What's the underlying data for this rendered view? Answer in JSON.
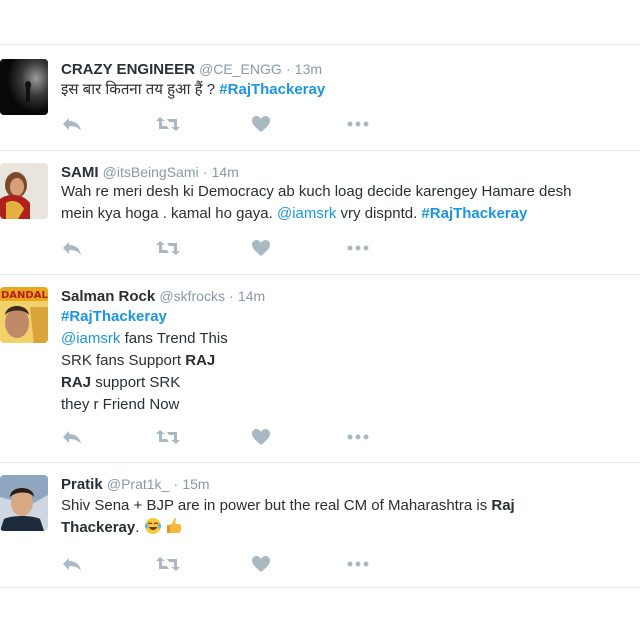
{
  "tweets": [
    {
      "name": "CRAZY ENGINEER",
      "handle": "@CE_ENGG",
      "sep": "·",
      "time": "13m",
      "text": "इस बार कितना तय हुआ हैं ?",
      "hashtag": "#RajThackeray"
    },
    {
      "name": "SAMI",
      "handle": "@itsBeingSami",
      "sep": "·",
      "time": "14m",
      "line1": "Wah re meri desh ki Democracy ab kuch loag decide karengey Hamare desh",
      "line2_text": "mein kya hoga . kamal ho gaya.",
      "mention": "@iamsrk",
      "line2_after": "vry dispntd.",
      "hashtag": "#RajThackeray"
    },
    {
      "name": "Salman Rock",
      "handle": "@skfrocks",
      "sep": "·",
      "time": "14m",
      "hashtag": "#RajThackeray",
      "mention": "@iamsrk",
      "line2_after": "fans Trend This",
      "line3_text": "SRK fans Support",
      "line3_bold": "RAJ",
      "line4_bold": "RAJ",
      "line4_text": "support SRK",
      "line5": "they r Friend Now",
      "avatar_text": "DANDAL"
    },
    {
      "name": "Pratik",
      "handle": "@Prat1k_",
      "sep": "·",
      "time": "15m",
      "line1_text": "Shiv Sena + BJP are in power but the real CM of Maharashtra is",
      "line1_bold": "Raj",
      "line2_bold": "Thackeray",
      "line2_after": ".",
      "emojis": [
        "face-with-tears-of-joy",
        "pointing-hand"
      ]
    }
  ],
  "icons": {
    "reply": "reply-icon",
    "retweet": "retweet-icon",
    "like": "heart-icon",
    "more": "more-icon"
  },
  "colors": {
    "link": "#1b95e0",
    "icon": "#aab8c2",
    "meta": "#8899a6",
    "text": "#292f33"
  }
}
